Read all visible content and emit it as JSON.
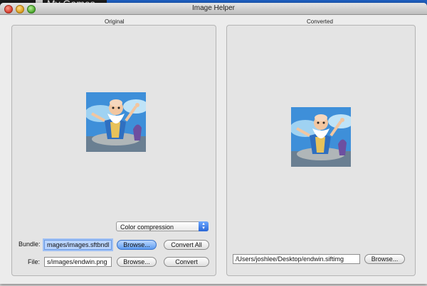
{
  "background": {
    "app_title": "My Games"
  },
  "window": {
    "title": "Image Helper"
  },
  "original_pane": {
    "label": "Original"
  },
  "converted_pane": {
    "label": "Converted",
    "file_path": "/Users/joshlee/Desktop/endwin.siftimg",
    "browse_label": "Browse..."
  },
  "controls": {
    "compression_select": "Color compression",
    "bundle_label": "Bundle:",
    "bundle_path": "mages/images.sftbndl",
    "bundle_browse": "Browse...",
    "convert_all": "Convert All",
    "file_label": "File:",
    "file_path": "s/images/endwin.png",
    "file_browse": "Browse...",
    "convert": "Convert"
  },
  "colors": {
    "accent": "#5d9bf0",
    "window_bg": "#ececec"
  }
}
